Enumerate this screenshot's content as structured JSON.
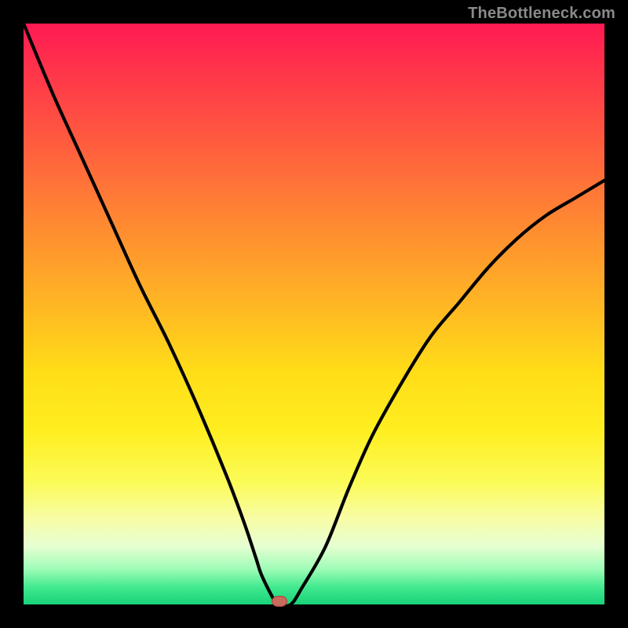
{
  "watermark": {
    "text": "TheBottleneck.com"
  },
  "chart_data": {
    "type": "line",
    "title": "",
    "xlabel": "",
    "ylabel": "",
    "xlim": [
      0,
      100
    ],
    "ylim": [
      0,
      100
    ],
    "grid": false,
    "legend": false,
    "background_gradient": {
      "top_color": "#ff1a52",
      "mid_color": "#ffdd18",
      "bottom_color": "#17d37a"
    },
    "series": [
      {
        "name": "curve",
        "stroke": "#000000",
        "x": [
          0,
          5,
          10,
          15,
          20,
          25,
          30,
          35,
          38,
          40,
          41,
          43,
          44,
          46,
          48,
          52,
          56,
          60,
          65,
          70,
          75,
          80,
          85,
          90,
          95,
          100
        ],
        "values": [
          100,
          88,
          77,
          66,
          55,
          45,
          34,
          22,
          14,
          8,
          5,
          1,
          0,
          0,
          3,
          10,
          20,
          29,
          38,
          46,
          52,
          58,
          63,
          67,
          70,
          73
        ]
      }
    ],
    "marker": {
      "x": 44,
      "y": 0.6,
      "fill": "#c86a5c",
      "stroke": "#a9443a"
    }
  }
}
